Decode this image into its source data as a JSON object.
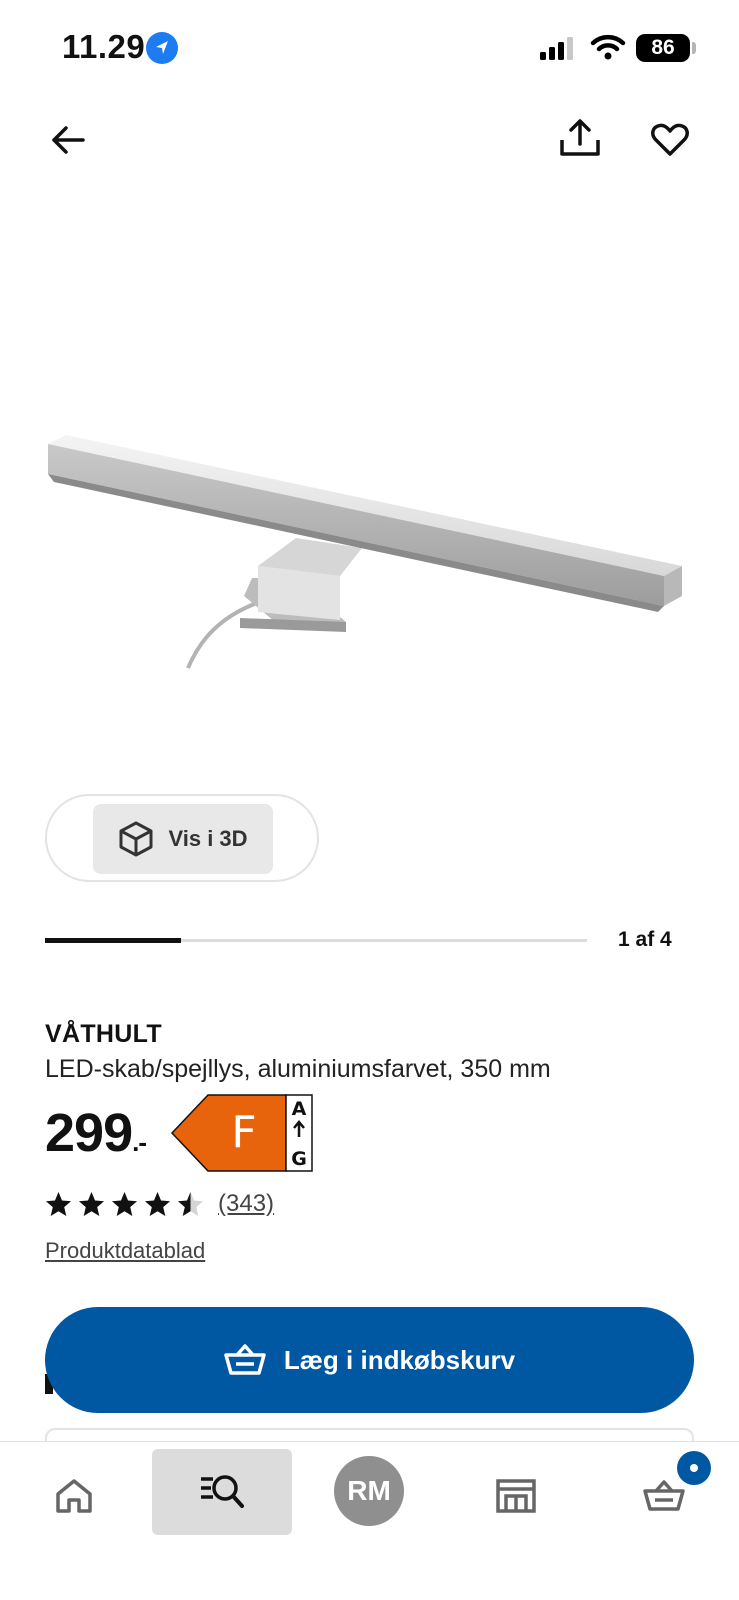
{
  "status_bar": {
    "time": "11.29",
    "battery": "86",
    "icons": [
      "location-arrow-icon",
      "signal-icon",
      "wifi-icon",
      "battery-icon"
    ]
  },
  "top_nav": {
    "icons": [
      "arrow-left-icon",
      "share-icon",
      "heart-icon"
    ]
  },
  "gallery": {
    "view3d_label": "Vis i 3D",
    "pager_text": "1 af 4",
    "pager_progress": 0.25
  },
  "product": {
    "name": "VÅTHULT",
    "description": "LED-skab/spejllys, aluminiumsfarvet, 350 mm",
    "price": "299",
    "price_suffix": ".-",
    "energy_class": "F",
    "energy_scale_top": "A",
    "energy_scale_bottom": "G",
    "energy_color": "#e8640c",
    "rating": 4.5,
    "review_count": "(343)",
    "datasheet_link": "Produktdatablad"
  },
  "actions": {
    "add_to_cart": "Læg i indkøbskurv",
    "accent_color": "#0058a3"
  },
  "tab_bar": {
    "profile_initials": "RM",
    "icons": [
      "home-icon",
      "search-list-icon",
      "store-icon",
      "basket-icon"
    ]
  }
}
